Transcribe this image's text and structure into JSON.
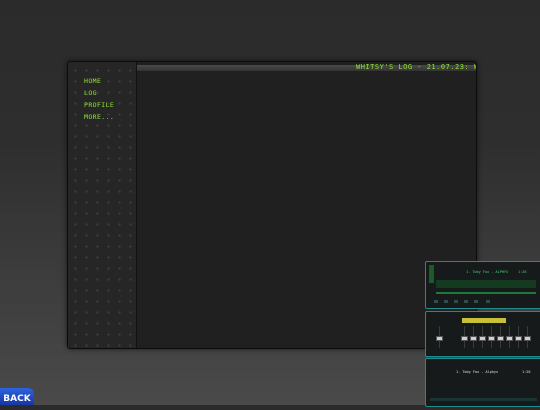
{
  "nav": {
    "items": [
      {
        "label": "HOME"
      },
      {
        "label": "LOG"
      },
      {
        "label": "PROFILE"
      },
      {
        "label": "MORE..."
      }
    ]
  },
  "marquee": {
    "text": "WHITSY'S LOG - 21.07.23: W"
  },
  "player": {
    "track": "1. Toby Fox - ALPHYS",
    "time": "1:26"
  },
  "playlist": {
    "track": "1. Toby Fox - Alphys",
    "time": "1:26"
  },
  "back_button": {
    "label": "BACK"
  },
  "colors": {
    "accent_green": "#8fe23a",
    "widget_border": "#1e8c8c",
    "back_blue": "#1f4ed1"
  }
}
